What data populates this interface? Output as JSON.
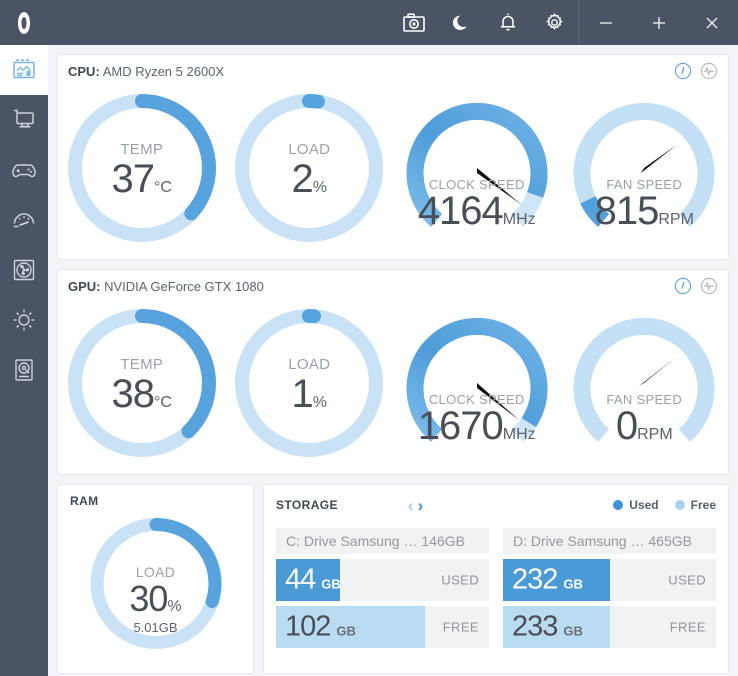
{
  "titlebar": {
    "logo_icon": "app-logo-icon",
    "buttons": [
      {
        "name": "screenshot-button",
        "icon": "camera-icon"
      },
      {
        "name": "night-mode-button",
        "icon": "moon-icon"
      },
      {
        "name": "alerts-button",
        "icon": "bell-icon"
      },
      {
        "name": "settings-button",
        "icon": "gear-icon"
      }
    ],
    "window": [
      {
        "name": "minimize-button",
        "glyph": "−"
      },
      {
        "name": "maximize-button",
        "glyph": "+"
      },
      {
        "name": "close-button",
        "glyph": "✕"
      }
    ]
  },
  "sidebar": {
    "items": [
      {
        "name": "sidebar-item-dashboard",
        "icon": "dashboard-icon",
        "active": true
      },
      {
        "name": "sidebar-item-monitor",
        "icon": "monitor-icon",
        "active": false
      },
      {
        "name": "sidebar-item-gaming",
        "icon": "gamepad-icon",
        "active": false
      },
      {
        "name": "sidebar-item-performance",
        "icon": "speedometer-icon",
        "active": false
      },
      {
        "name": "sidebar-item-fan",
        "icon": "fan-icon",
        "active": false
      },
      {
        "name": "sidebar-item-lighting",
        "icon": "sun-icon",
        "active": false
      },
      {
        "name": "sidebar-item-storage",
        "icon": "hard-drive-icon",
        "active": false
      }
    ]
  },
  "colors": {
    "titlebar_bg": "#4a5464",
    "accent_dark": "#4a9ad8",
    "accent_mid": "#5aa8e0",
    "accent_light": "#bfdff4",
    "track": "#c9e2f6",
    "text_dark": "#4a4f57",
    "text_muted": "#9aa1ab"
  },
  "cpu": {
    "section_label": "CPU:",
    "device": "AMD Ryzen 5 2600X",
    "view_gauge_icon": "gauge-view-icon",
    "view_graph_icon": "graph-view-icon",
    "gauges": [
      {
        "name": "cpu-temp-gauge",
        "style": "donut",
        "label": "TEMP",
        "value": "37",
        "unit": "°C",
        "percent": 37
      },
      {
        "name": "cpu-load-gauge",
        "style": "donut",
        "label": "LOAD",
        "value": "2",
        "unit": "%",
        "percent": 2
      },
      {
        "name": "cpu-clock-gauge",
        "style": "speedo",
        "label": "CLOCK SPEED",
        "value": "4164",
        "unit": "MHz",
        "percent": 92
      },
      {
        "name": "cpu-fan-gauge",
        "style": "speedo",
        "label": "FAN SPEED",
        "value": "815",
        "unit": "RPM",
        "percent": 9
      }
    ]
  },
  "gpu": {
    "section_label": "GPU:",
    "device": "NVIDIA GeForce GTX 1080",
    "view_gauge_icon": "gauge-view-icon",
    "view_graph_icon": "graph-view-icon",
    "gauges": [
      {
        "name": "gpu-temp-gauge",
        "style": "donut",
        "label": "TEMP",
        "value": "38",
        "unit": "°C",
        "percent": 38
      },
      {
        "name": "gpu-load-gauge",
        "style": "donut",
        "label": "LOAD",
        "value": "1",
        "unit": "%",
        "percent": 1
      },
      {
        "name": "gpu-clock-gauge",
        "style": "speedo",
        "label": "CLOCK SPEED",
        "value": "1670",
        "unit": "MHz",
        "percent": 96
      },
      {
        "name": "gpu-fan-gauge",
        "style": "speedo",
        "label": "FAN SPEED",
        "value": "0",
        "unit": "RPM",
        "percent": 0
      }
    ]
  },
  "ram": {
    "title": "RAM",
    "label": "LOAD",
    "value": "30",
    "unit": "%",
    "sub": "5.01GB",
    "percent": 30
  },
  "storage": {
    "title": "STORAGE",
    "prev_glyph": "‹",
    "next_glyph": "›",
    "legend": [
      {
        "name": "legend-used",
        "label": "Used",
        "color": "#3d92d8"
      },
      {
        "name": "legend-free",
        "label": "Free",
        "color": "#a8d4ef"
      }
    ],
    "drives": [
      {
        "name": "C: Drive Samsung … 146GB",
        "used_value": "44",
        "used_unit": "GB",
        "used_tag": "USED",
        "used_percent": 30,
        "free_value": "102",
        "free_unit": "GB",
        "free_tag": "FREE",
        "free_percent": 70
      },
      {
        "name": "D: Drive Samsung … 465GB",
        "used_value": "232",
        "used_unit": "GB",
        "used_tag": "USED",
        "used_percent": 50,
        "free_value": "233",
        "free_unit": "GB",
        "free_tag": "FREE",
        "free_percent": 50
      }
    ]
  }
}
